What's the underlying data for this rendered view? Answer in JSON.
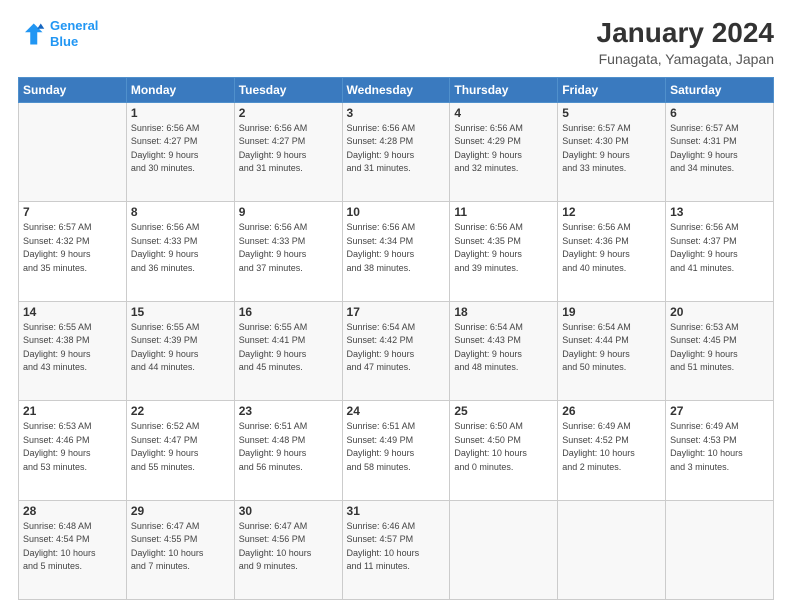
{
  "logo": {
    "line1": "General",
    "line2": "Blue"
  },
  "title": "January 2024",
  "subtitle": "Funagata, Yamagata, Japan",
  "weekdays": [
    "Sunday",
    "Monday",
    "Tuesday",
    "Wednesday",
    "Thursday",
    "Friday",
    "Saturday"
  ],
  "weeks": [
    [
      {
        "day": "",
        "info": ""
      },
      {
        "day": "1",
        "info": "Sunrise: 6:56 AM\nSunset: 4:27 PM\nDaylight: 9 hours\nand 30 minutes."
      },
      {
        "day": "2",
        "info": "Sunrise: 6:56 AM\nSunset: 4:27 PM\nDaylight: 9 hours\nand 31 minutes."
      },
      {
        "day": "3",
        "info": "Sunrise: 6:56 AM\nSunset: 4:28 PM\nDaylight: 9 hours\nand 31 minutes."
      },
      {
        "day": "4",
        "info": "Sunrise: 6:56 AM\nSunset: 4:29 PM\nDaylight: 9 hours\nand 32 minutes."
      },
      {
        "day": "5",
        "info": "Sunrise: 6:57 AM\nSunset: 4:30 PM\nDaylight: 9 hours\nand 33 minutes."
      },
      {
        "day": "6",
        "info": "Sunrise: 6:57 AM\nSunset: 4:31 PM\nDaylight: 9 hours\nand 34 minutes."
      }
    ],
    [
      {
        "day": "7",
        "info": "Sunrise: 6:57 AM\nSunset: 4:32 PM\nDaylight: 9 hours\nand 35 minutes."
      },
      {
        "day": "8",
        "info": "Sunrise: 6:56 AM\nSunset: 4:33 PM\nDaylight: 9 hours\nand 36 minutes."
      },
      {
        "day": "9",
        "info": "Sunrise: 6:56 AM\nSunset: 4:33 PM\nDaylight: 9 hours\nand 37 minutes."
      },
      {
        "day": "10",
        "info": "Sunrise: 6:56 AM\nSunset: 4:34 PM\nDaylight: 9 hours\nand 38 minutes."
      },
      {
        "day": "11",
        "info": "Sunrise: 6:56 AM\nSunset: 4:35 PM\nDaylight: 9 hours\nand 39 minutes."
      },
      {
        "day": "12",
        "info": "Sunrise: 6:56 AM\nSunset: 4:36 PM\nDaylight: 9 hours\nand 40 minutes."
      },
      {
        "day": "13",
        "info": "Sunrise: 6:56 AM\nSunset: 4:37 PM\nDaylight: 9 hours\nand 41 minutes."
      }
    ],
    [
      {
        "day": "14",
        "info": "Sunrise: 6:55 AM\nSunset: 4:38 PM\nDaylight: 9 hours\nand 43 minutes."
      },
      {
        "day": "15",
        "info": "Sunrise: 6:55 AM\nSunset: 4:39 PM\nDaylight: 9 hours\nand 44 minutes."
      },
      {
        "day": "16",
        "info": "Sunrise: 6:55 AM\nSunset: 4:41 PM\nDaylight: 9 hours\nand 45 minutes."
      },
      {
        "day": "17",
        "info": "Sunrise: 6:54 AM\nSunset: 4:42 PM\nDaylight: 9 hours\nand 47 minutes."
      },
      {
        "day": "18",
        "info": "Sunrise: 6:54 AM\nSunset: 4:43 PM\nDaylight: 9 hours\nand 48 minutes."
      },
      {
        "day": "19",
        "info": "Sunrise: 6:54 AM\nSunset: 4:44 PM\nDaylight: 9 hours\nand 50 minutes."
      },
      {
        "day": "20",
        "info": "Sunrise: 6:53 AM\nSunset: 4:45 PM\nDaylight: 9 hours\nand 51 minutes."
      }
    ],
    [
      {
        "day": "21",
        "info": "Sunrise: 6:53 AM\nSunset: 4:46 PM\nDaylight: 9 hours\nand 53 minutes."
      },
      {
        "day": "22",
        "info": "Sunrise: 6:52 AM\nSunset: 4:47 PM\nDaylight: 9 hours\nand 55 minutes."
      },
      {
        "day": "23",
        "info": "Sunrise: 6:51 AM\nSunset: 4:48 PM\nDaylight: 9 hours\nand 56 minutes."
      },
      {
        "day": "24",
        "info": "Sunrise: 6:51 AM\nSunset: 4:49 PM\nDaylight: 9 hours\nand 58 minutes."
      },
      {
        "day": "25",
        "info": "Sunrise: 6:50 AM\nSunset: 4:50 PM\nDaylight: 10 hours\nand 0 minutes."
      },
      {
        "day": "26",
        "info": "Sunrise: 6:49 AM\nSunset: 4:52 PM\nDaylight: 10 hours\nand 2 minutes."
      },
      {
        "day": "27",
        "info": "Sunrise: 6:49 AM\nSunset: 4:53 PM\nDaylight: 10 hours\nand 3 minutes."
      }
    ],
    [
      {
        "day": "28",
        "info": "Sunrise: 6:48 AM\nSunset: 4:54 PM\nDaylight: 10 hours\nand 5 minutes."
      },
      {
        "day": "29",
        "info": "Sunrise: 6:47 AM\nSunset: 4:55 PM\nDaylight: 10 hours\nand 7 minutes."
      },
      {
        "day": "30",
        "info": "Sunrise: 6:47 AM\nSunset: 4:56 PM\nDaylight: 10 hours\nand 9 minutes."
      },
      {
        "day": "31",
        "info": "Sunrise: 6:46 AM\nSunset: 4:57 PM\nDaylight: 10 hours\nand 11 minutes."
      },
      {
        "day": "",
        "info": ""
      },
      {
        "day": "",
        "info": ""
      },
      {
        "day": "",
        "info": ""
      }
    ]
  ]
}
